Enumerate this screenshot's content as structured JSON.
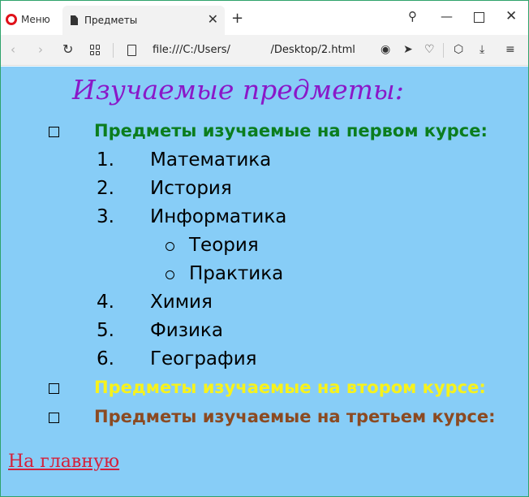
{
  "browser": {
    "menu_label": "Меню",
    "tab_title": "Предметы",
    "url": "file:///C:/Users/            /Desktop/2.html",
    "icons": {
      "menu": "opera-logo-icon",
      "tab": "document-icon",
      "close_tab": "close-icon",
      "new_tab": "plus-icon",
      "search": "search-icon",
      "minimize": "minimize-icon",
      "maximize": "maximize-icon",
      "close_window": "close-icon",
      "back": "chevron-left-icon",
      "forward": "chevron-right-icon",
      "reload": "reload-icon",
      "speed_dial": "grid-icon",
      "page": "document-icon",
      "snapshot": "camera-icon",
      "send": "send-icon",
      "bookmark": "heart-icon",
      "extensions": "cube-icon",
      "download": "download-icon",
      "easy_setup": "settings-sliders-icon"
    }
  },
  "page": {
    "background": "#87cdf7",
    "heading": "Изучаемые предметы:",
    "heading_color": "#8a18c8",
    "courses": [
      {
        "label": "Предметы изучаемые на первом курсе:",
        "color": "#0b7d1e",
        "subjects": [
          {
            "num": "1.",
            "name": "Математика"
          },
          {
            "num": "2.",
            "name": "История"
          },
          {
            "num": "3.",
            "name": "Информатика",
            "children": [
              "Теория",
              "Практика"
            ]
          },
          {
            "num": "4.",
            "name": "Химия"
          },
          {
            "num": "5.",
            "name": "Физика"
          },
          {
            "num": "6.",
            "name": "География"
          }
        ]
      },
      {
        "label": "Предметы изучаемые на втором курсе:",
        "color": "#f7f21c"
      },
      {
        "label": "Предметы изучаемые на третьем курсе:",
        "color": "#8b4a22"
      }
    ],
    "home_link": "На главную",
    "link_color": "#d4203a"
  }
}
